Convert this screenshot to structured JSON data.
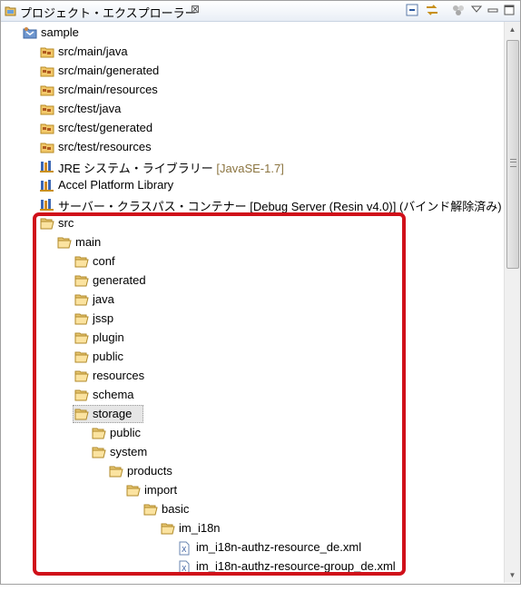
{
  "view": {
    "title": "プロジェクト・エクスプローラー",
    "close_glyph": "⊠",
    "toolbar": [
      "collapse-all-icon",
      "link-with-editor-icon",
      "filters-icon",
      "view-menu-icon",
      "minimize-icon",
      "maximize-icon"
    ]
  },
  "tree": [
    {
      "label": "sample",
      "icon": "java-project-icon",
      "level": 0
    },
    {
      "label": "src/main/java",
      "icon": "source-folder-icon",
      "level": 1
    },
    {
      "label": "src/main/generated",
      "icon": "source-folder-icon",
      "level": 1
    },
    {
      "label": "src/main/resources",
      "icon": "source-folder-icon",
      "level": 1
    },
    {
      "label": "src/test/java",
      "icon": "source-folder-icon",
      "level": 1
    },
    {
      "label": "src/test/generated",
      "icon": "source-folder-icon",
      "level": 1
    },
    {
      "label": "src/test/resources",
      "icon": "source-folder-icon",
      "level": 1
    },
    {
      "label": "JRE システム・ライブラリー",
      "decoration": "[JavaSE-1.7]",
      "icon": "library-icon",
      "level": 1
    },
    {
      "label": "Accel Platform Library",
      "icon": "library-icon",
      "level": 1
    },
    {
      "label": "サーバー・クラスパス・コンテナー [Debug Server (Resin v4.0)] (バインド解除済み)",
      "icon": "library-icon",
      "level": 1
    },
    {
      "label": "src",
      "icon": "folder-open-icon",
      "level": 1
    },
    {
      "label": "main",
      "icon": "folder-open-icon",
      "level": 2
    },
    {
      "label": "conf",
      "icon": "folder-open-icon",
      "level": 3
    },
    {
      "label": "generated",
      "icon": "folder-open-icon",
      "level": 3
    },
    {
      "label": "java",
      "icon": "folder-open-icon",
      "level": 3
    },
    {
      "label": "jssp",
      "icon": "folder-open-icon",
      "level": 3
    },
    {
      "label": "plugin",
      "icon": "folder-open-icon",
      "level": 3
    },
    {
      "label": "public",
      "icon": "folder-open-icon",
      "level": 3
    },
    {
      "label": "resources",
      "icon": "folder-open-icon",
      "level": 3
    },
    {
      "label": "schema",
      "icon": "folder-open-icon",
      "level": 3
    },
    {
      "label": "storage",
      "icon": "folder-open-icon",
      "level": 3,
      "selected": true
    },
    {
      "label": "public",
      "icon": "folder-open-icon",
      "level": 4
    },
    {
      "label": "system",
      "icon": "folder-open-icon",
      "level": 4
    },
    {
      "label": "products",
      "icon": "folder-open-icon",
      "level": 5
    },
    {
      "label": "import",
      "icon": "folder-open-icon",
      "level": 6
    },
    {
      "label": "basic",
      "icon": "folder-open-icon",
      "level": 7
    },
    {
      "label": "im_i18n",
      "icon": "folder-open-icon",
      "level": 8
    },
    {
      "label": "im_i18n-authz-resource_de.xml",
      "icon": "xml-file-icon",
      "level": 9
    },
    {
      "label": "im_i18n-authz-resource-group_de.xml",
      "icon": "xml-file-icon",
      "level": 9
    }
  ],
  "colors": {
    "highlight": "#d0101a",
    "decoration": "#8b7440"
  }
}
